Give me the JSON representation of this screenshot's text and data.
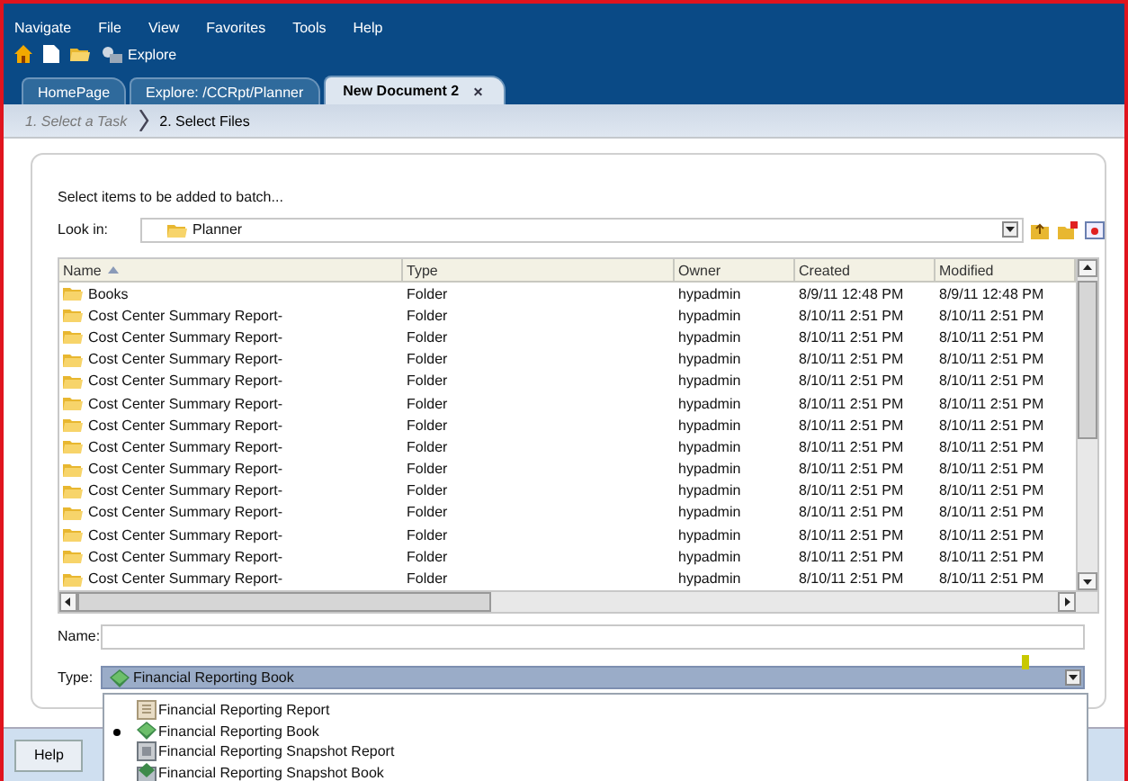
{
  "menu": [
    "Navigate",
    "File",
    "View",
    "Favorites",
    "Tools",
    "Help"
  ],
  "toolbar": [
    {
      "kind": "home"
    },
    {
      "kind": "document"
    },
    {
      "kind": "folder"
    },
    {
      "kind": "explore",
      "label": "Explore"
    }
  ],
  "tabs": [
    {
      "label": "HomePage",
      "selected": false
    },
    {
      "label": "Explore: /CCRpt/Planner",
      "selected": false
    },
    {
      "label": "New Document 2",
      "selected": true,
      "close": "×"
    }
  ],
  "breadcrumb": [
    {
      "label": "1. Select a Task",
      "selected": false
    },
    {
      "label": "2. Select Files",
      "selected": true
    }
  ],
  "prompt": "Select items to be added to batch...",
  "look_in": {
    "label": "Look in:",
    "value": "Planner"
  },
  "table": {
    "columns": [
      {
        "label": "Name",
        "sorted": true
      },
      {
        "label": "Type"
      },
      {
        "label": "Owner"
      },
      {
        "label": "Created"
      },
      {
        "label": "Modified"
      }
    ],
    "rows": [
      [
        "Books",
        "Folder",
        "hypadmin",
        "8/9/11 12:48 PM",
        "8/9/11 12:48 PM"
      ],
      [
        "Cost Center Summary Report-",
        "Folder",
        "hypadmin",
        "8/10/11 2:51 PM",
        "8/10/11 2:51 PM"
      ],
      [
        "Cost Center Summary Report-",
        "Folder",
        "hypadmin",
        "8/10/11 2:51 PM",
        "8/10/11 2:51 PM"
      ],
      [
        "Cost Center Summary Report-",
        "Folder",
        "hypadmin",
        "8/10/11 2:51 PM",
        "8/10/11 2:51 PM"
      ],
      [
        "Cost Center Summary Report-",
        "Folder",
        "hypadmin",
        "8/10/11 2:51 PM",
        "8/10/11 2:51 PM"
      ],
      [
        "Cost Center Summary Report-",
        "Folder",
        "hypadmin",
        "8/10/11 2:51 PM",
        "8/10/11 2:51 PM"
      ],
      [
        "Cost Center Summary Report-",
        "Folder",
        "hypadmin",
        "8/10/11 2:51 PM",
        "8/10/11 2:51 PM"
      ],
      [
        "Cost Center Summary Report-",
        "Folder",
        "hypadmin",
        "8/10/11 2:51 PM",
        "8/10/11 2:51 PM"
      ],
      [
        "Cost Center Summary Report-",
        "Folder",
        "hypadmin",
        "8/10/11 2:51 PM",
        "8/10/11 2:51 PM"
      ],
      [
        "Cost Center Summary Report-",
        "Folder",
        "hypadmin",
        "8/10/11 2:51 PM",
        "8/10/11 2:51 PM"
      ],
      [
        "Cost Center Summary Report-",
        "Folder",
        "hypadmin",
        "8/10/11 2:51 PM",
        "8/10/11 2:51 PM"
      ],
      [
        "Cost Center Summary Report-",
        "Folder",
        "hypadmin",
        "8/10/11 2:51 PM",
        "8/10/11 2:51 PM"
      ],
      [
        "Cost Center Summary Report-",
        "Folder",
        "hypadmin",
        "8/10/11 2:51 PM",
        "8/10/11 2:51 PM"
      ],
      [
        "Cost Center Summary Report-",
        "Folder",
        "hypadmin",
        "8/10/11 2:51 PM",
        "8/10/11 2:51 PM"
      ]
    ]
  },
  "name_field": {
    "label": "Name:"
  },
  "type_field": {
    "label": "Type:",
    "value": "Financial Reporting Book",
    "kind": "book"
  },
  "type_options": [
    {
      "label": "Financial Reporting Report",
      "kind": "report",
      "selected": false
    },
    {
      "label": "Financial Reporting Book",
      "kind": "book",
      "selected": true
    },
    {
      "label": "Financial Reporting Snapshot Report",
      "kind": "snapshot-report",
      "selected": false
    },
    {
      "label": "Financial Reporting Snapshot Book",
      "kind": "snapshot-book",
      "selected": false
    }
  ],
  "help_button": "Help"
}
